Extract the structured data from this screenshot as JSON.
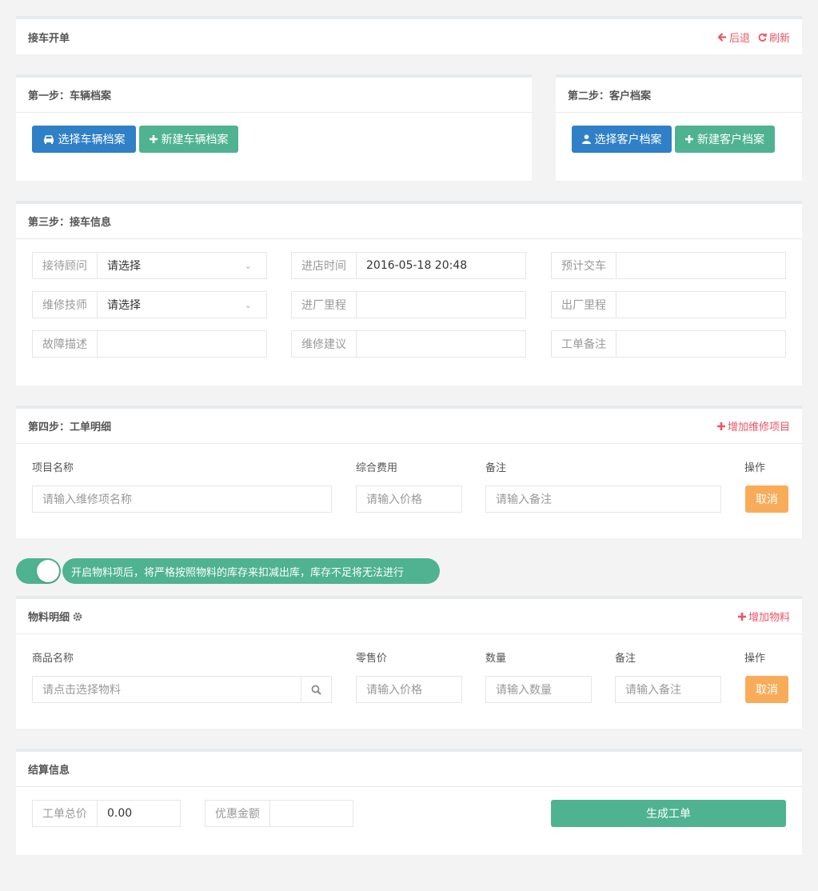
{
  "header": {
    "title": "接车开单",
    "back_label": "后退",
    "refresh_label": "刷新"
  },
  "step1": {
    "title": "第一步：车辆档案",
    "select_label": "选择车辆档案",
    "new_label": "新建车辆档案"
  },
  "step2": {
    "title": "第二步：客户档案",
    "select_label": "选择客户档案",
    "new_label": "新建客户档案"
  },
  "step3": {
    "title": "第三步：接车信息",
    "fields": {
      "advisor": {
        "label": "接待顾问",
        "value": "请选择"
      },
      "entry_time": {
        "label": "进店时间",
        "value": "2016-05-18 20:48"
      },
      "expected_delivery": {
        "label": "预计交车",
        "value": ""
      },
      "technician": {
        "label": "维修技师",
        "value": "请选择"
      },
      "entry_mileage": {
        "label": "进厂里程",
        "value": ""
      },
      "exit_mileage": {
        "label": "出厂里程",
        "value": ""
      },
      "fault": {
        "label": "故障描述",
        "value": ""
      },
      "suggestion": {
        "label": "维修建议",
        "value": ""
      },
      "remark": {
        "label": "工单备注",
        "value": ""
      }
    }
  },
  "step4": {
    "title": "第四步：工单明细",
    "add_label": "增加维修项目",
    "columns": [
      "项目名称",
      "综合费用",
      "备注",
      "操作"
    ],
    "row": {
      "name_placeholder": "请输入维修项名称",
      "price_placeholder": "请输入价格",
      "remark_placeholder": "请输入备注",
      "cancel_label": "取消"
    }
  },
  "material_notice": "开启物料项后，将严格按照物料的库存来扣减出库，库存不足将无法进行",
  "materials": {
    "title": "物料明细",
    "add_label": "增加物料",
    "columns": [
      "商品名称",
      "零售价",
      "数量",
      "备注",
      "操作"
    ],
    "row": {
      "name_placeholder": "请点击选择物料",
      "price_placeholder": "请输入价格",
      "qty_placeholder": "请输入数量",
      "remark_placeholder": "请输入备注",
      "cancel_label": "取消"
    }
  },
  "settlement": {
    "title": "结算信息",
    "total_label": "工单总价",
    "total_value": "0.00",
    "discount_label": "优惠金额",
    "discount_value": "",
    "submit_label": "生成工单"
  },
  "colors": {
    "primary_blue": "#2f80c6",
    "green": "#4fb290",
    "orange": "#f8ac59",
    "red_link": "#ed5565"
  }
}
